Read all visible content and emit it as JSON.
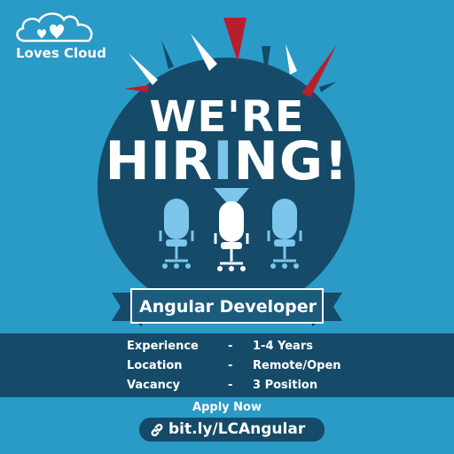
{
  "brand": {
    "name": "Loves Cloud",
    "icon": "cloud-heart-icon"
  },
  "headline": {
    "line1": "WE'RE",
    "line2_before": "HIR",
    "line2_accent": "I",
    "line2_after": "NG!"
  },
  "position": {
    "title": "Angular Developer"
  },
  "details": [
    {
      "label": "Experience",
      "separator": "-",
      "value": "1-4 Years"
    },
    {
      "label": "Location",
      "separator": "-",
      "value": "Remote/Open"
    },
    {
      "label": "Vacancy",
      "separator": "-",
      "value": "3 Position"
    }
  ],
  "cta": {
    "label": "Apply Now",
    "link": "bit.ly/LCAngular",
    "link_icon": "link-icon"
  },
  "colors": {
    "background": "#2a9ac7",
    "circle": "#154a68",
    "accent_light": "#7cc6ec",
    "burst_red": "#b81f2c",
    "chair_highlight": "#ffffff"
  }
}
